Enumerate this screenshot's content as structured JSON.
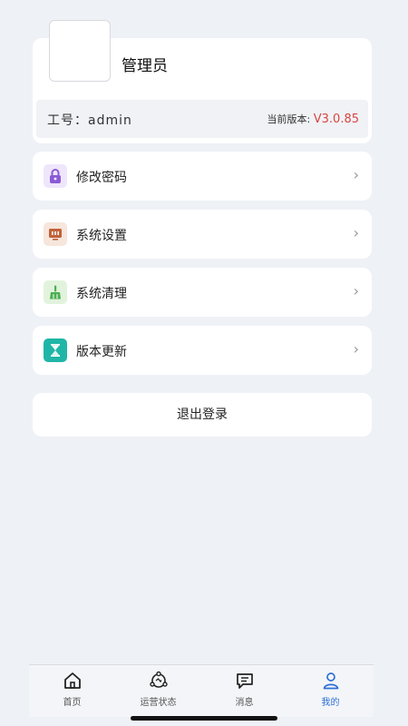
{
  "profile": {
    "username": "管理员",
    "employee_id": "工号：admin",
    "version_label": "当前版本:",
    "version_value": "V3.0.85"
  },
  "menu": [
    {
      "label": "修改密码",
      "icon": "lock-icon",
      "color": "#8a5bd6"
    },
    {
      "label": "系统设置",
      "icon": "settings-panel-icon",
      "color": "#c0623b"
    },
    {
      "label": "系统清理",
      "icon": "broom-icon",
      "color": "#4caf50"
    },
    {
      "label": "版本更新",
      "icon": "hourglass-icon",
      "color": "#1fb6a8"
    }
  ],
  "logout_label": "退出登录",
  "tabs": [
    {
      "label": "首页",
      "icon": "home-icon"
    },
    {
      "label": "运营状态",
      "icon": "network-status-icon"
    },
    {
      "label": "消息",
      "icon": "message-icon"
    },
    {
      "label": "我的",
      "icon": "user-icon",
      "active": true
    }
  ],
  "colors": {
    "accent": "#2f6fd6",
    "version_red": "#d9443f",
    "background": "#eef1f6"
  }
}
